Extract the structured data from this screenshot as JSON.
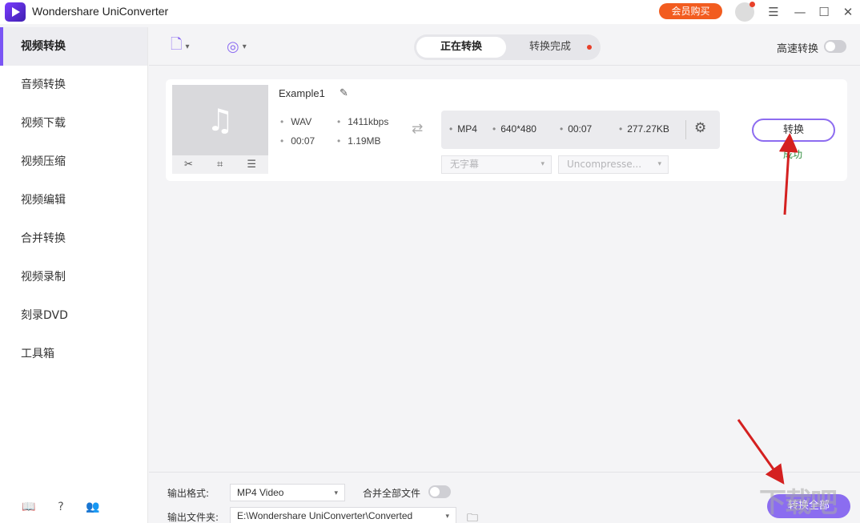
{
  "app": {
    "title": "Wondershare UniConverter",
    "buy_label": "会员购买"
  },
  "sidebar": {
    "items": [
      {
        "label": "视频转换"
      },
      {
        "label": "音频转换"
      },
      {
        "label": "视频下载"
      },
      {
        "label": "视频压缩"
      },
      {
        "label": "视频编辑"
      },
      {
        "label": "合并转换"
      },
      {
        "label": "视频录制"
      },
      {
        "label": "刻录DVD"
      },
      {
        "label": "工具箱"
      }
    ]
  },
  "toolbar": {
    "tabs": [
      {
        "label": "正在转换"
      },
      {
        "label": "转换完成"
      }
    ],
    "speed_label": "高速转换"
  },
  "file": {
    "name": "Example1",
    "source": {
      "format": "WAV",
      "bitrate": "1411kbps",
      "duration": "00:07",
      "size": "1.19MB"
    },
    "output": {
      "format": "MP4",
      "resolution": "640*480",
      "duration": "00:07",
      "size": "277.27KB"
    },
    "subtitle": "无字幕",
    "audio": "Uncompresse...",
    "convert_label": "转换",
    "status": "成功"
  },
  "footer": {
    "format_label": "输出格式:",
    "format_value": "MP4 Video",
    "merge_label": "合并全部文件",
    "folder_label": "输出文件夹:",
    "folder_value": "E:\\Wondershare UniConverter\\Converted",
    "convert_all_label": "转换全部"
  },
  "colors": {
    "accent": "#8b6df0",
    "buy": "#f25c1f",
    "success": "#2e8b3c",
    "arrow": "#d42020"
  }
}
